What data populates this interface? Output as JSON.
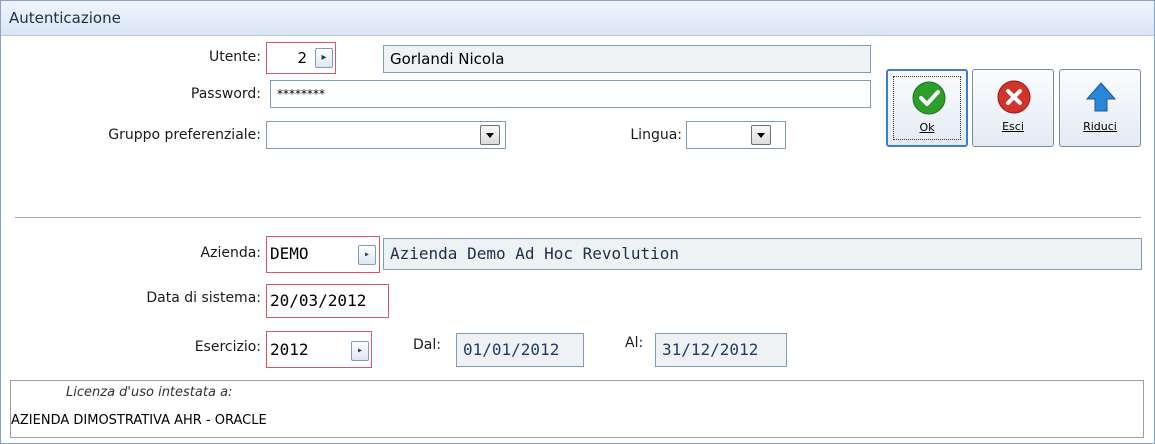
{
  "window": {
    "title": "Autenticazione"
  },
  "login": {
    "utente_label": "Utente:",
    "utente_code": "2",
    "utente_name": "Gorlandi Nicola",
    "password_label": "Password:",
    "password_value": "********",
    "gruppo_label": "Gruppo preferenziale:",
    "gruppo_value": "",
    "lingua_label": "Lingua:",
    "lingua_value": ""
  },
  "buttons": {
    "ok_label": "Ok",
    "esci_label": "Esci",
    "riduci_label": "Riduci"
  },
  "company": {
    "azienda_label": "Azienda:",
    "azienda_code": "DEMO",
    "azienda_name": "Azienda Demo Ad Hoc Revolution",
    "data_label": "Data di sistema:",
    "data_value": "20/03/2012",
    "esercizio_label": "Esercizio:",
    "esercizio_value": "2012",
    "dal_label": "Dal:",
    "dal_value": "01/01/2012",
    "al_label": "Al:",
    "al_value": "31/12/2012"
  },
  "license": {
    "heading": "Licenza d'uso intestata a:",
    "holder": "AZIENDA DIMOSTRATIVA AHR - ORACLE"
  },
  "colors": {
    "required_border": "#d9566a",
    "field_border": "#7f9db9",
    "title_bg": "#d9e5f5",
    "ok_icon": "#2e9e2a",
    "esci_icon": "#d2332b",
    "riduci_icon": "#2a86d8"
  },
  "icons": [
    "check-icon",
    "close-icon",
    "arrow-up-icon",
    "chevron-right-icon",
    "dropdown-arrow-icon"
  ]
}
